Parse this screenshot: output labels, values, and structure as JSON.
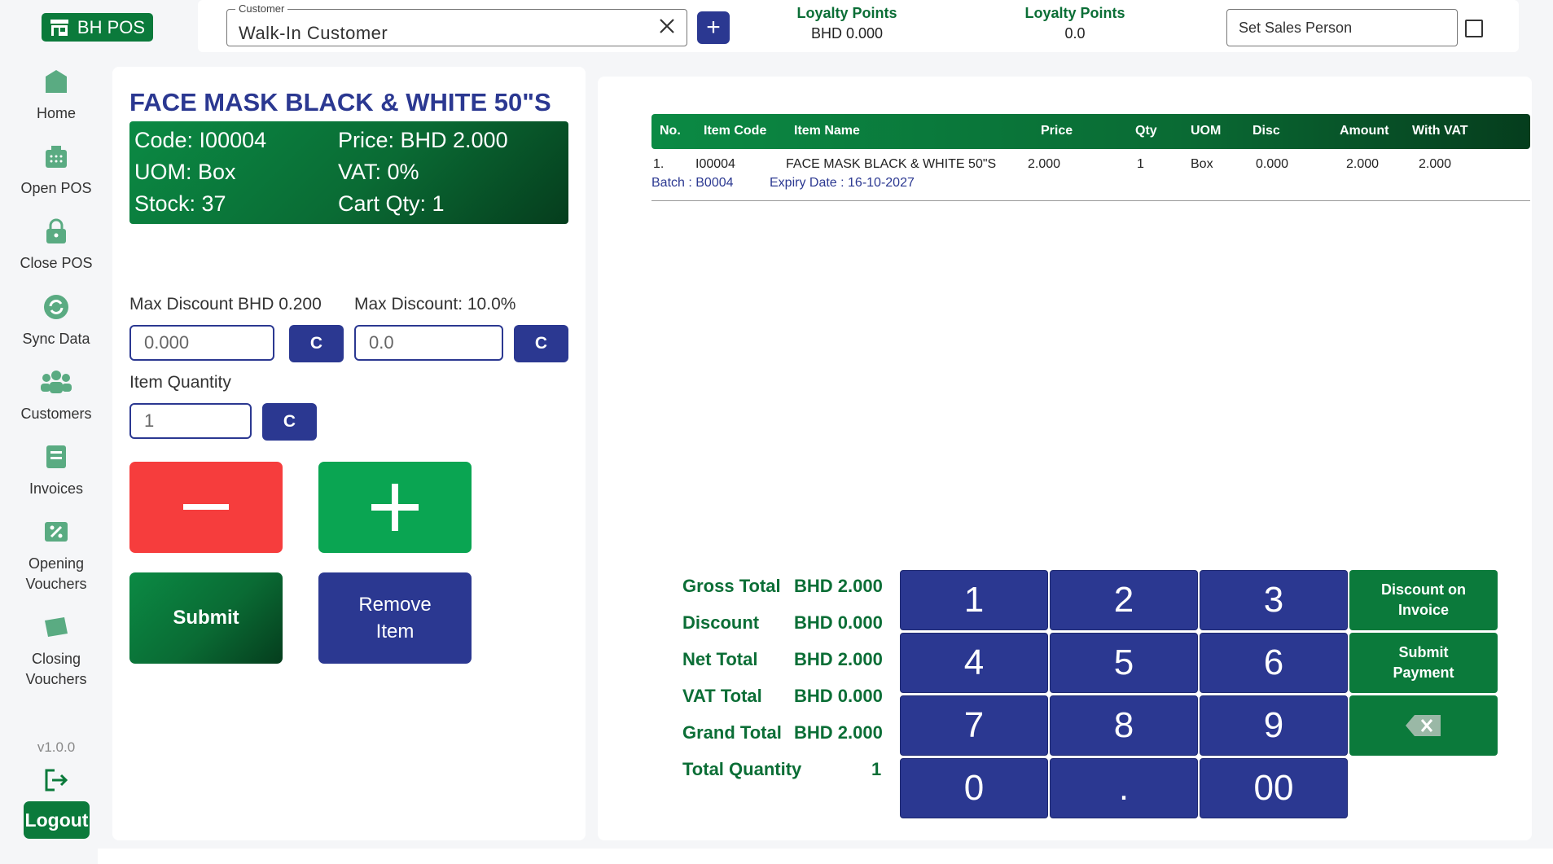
{
  "app": {
    "brand": "BH POS",
    "version": "v1.0.0",
    "logout_label": "Logout"
  },
  "sidebar": {
    "items": [
      {
        "label": "Home"
      },
      {
        "label": "Open POS"
      },
      {
        "label": "Close POS"
      },
      {
        "label": "Sync Data"
      },
      {
        "label": "Customers"
      },
      {
        "label": "Invoices"
      },
      {
        "label": "Opening\nVouchers"
      },
      {
        "label": "Closing\nVouchers"
      }
    ]
  },
  "topbar": {
    "customer_legend": "Customer",
    "customer_value": "Walk-In Customer",
    "add_label": "+",
    "loyalty1_title": "Loyalty Points",
    "loyalty1_value": "BHD  0.000",
    "loyalty2_title": "Loyalty Points",
    "loyalty2_value": "0.0",
    "sales_person_placeholder": "Set Sales Person"
  },
  "product": {
    "name": "FACE MASK BLACK & WHITE 50\"S",
    "code": "Code: I00004",
    "price": "Price: BHD 2.000",
    "uom": "UOM: Box",
    "vat": "VAT: 0%",
    "stock": "Stock: 37",
    "cart_qty": "Cart Qty: 1"
  },
  "discount": {
    "max_amount_label": "Max Discount BHD 0.200",
    "max_percent_label": "Max Discount: 10.0%",
    "amount_value": "0.000",
    "percent_value": "0.0",
    "clear_label": "C"
  },
  "quantity": {
    "label": "Item Quantity",
    "value": "1",
    "clear_label": "C"
  },
  "actions": {
    "submit": "Submit",
    "remove": "Remove\nItem"
  },
  "table": {
    "headers": [
      "No.",
      "Item Code",
      "Item Name",
      "Price",
      "Qty",
      "UOM",
      "Disc",
      "Amount",
      "With VAT"
    ],
    "rows": [
      {
        "no": "1.",
        "code": "I00004",
        "name": "FACE MASK BLACK & WHITE 50\"S",
        "price": "2.000",
        "qty": "1",
        "uom": "Box",
        "disc": "0.000",
        "amount": "2.000",
        "with_vat": "2.000",
        "batch": "Batch : B0004",
        "expiry": "Expiry Date : 16-10-2027"
      }
    ]
  },
  "totals": [
    {
      "label": "Gross Total",
      "value": "BHD 2.000"
    },
    {
      "label": "Discount",
      "value": "BHD 0.000"
    },
    {
      "label": "Net Total",
      "value": "BHD 2.000"
    },
    {
      "label": "VAT Total",
      "value": "BHD 0.000"
    },
    {
      "label": "Grand Total",
      "value": "BHD 2.000"
    },
    {
      "label": "Total Quantity",
      "value": "1"
    }
  ],
  "keypad": {
    "keys": [
      "1",
      "2",
      "3",
      "4",
      "5",
      "6",
      "7",
      "8",
      "9",
      "0",
      ".",
      "00"
    ],
    "discount_on_invoice": "Discount on\nInvoice",
    "submit_payment": "Submit\nPayment"
  },
  "colors": {
    "green": "#0b7a3b",
    "navy": "#2b3891",
    "red": "#f63d3d",
    "bright_green": "#0aa552"
  }
}
